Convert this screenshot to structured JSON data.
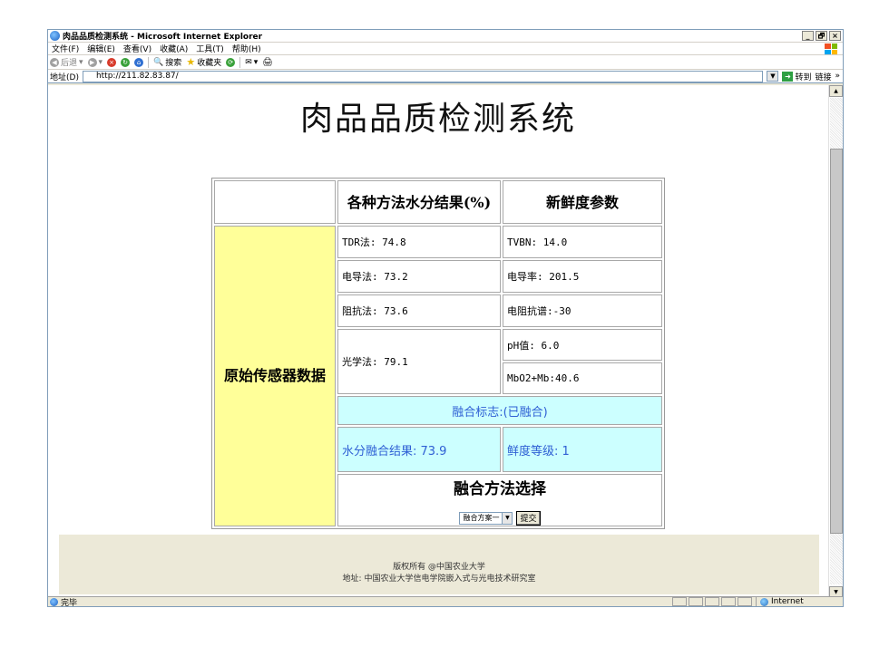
{
  "window": {
    "title": "肉品品质检测系统 - Microsoft Internet Explorer",
    "controls": [
      "_",
      "🗗",
      "×"
    ]
  },
  "menubar": {
    "items": [
      "文件(F)",
      "编辑(E)",
      "查看(V)",
      "收藏(A)",
      "工具(T)",
      "帮助(H)"
    ]
  },
  "toolbar": {
    "back": "后退",
    "search": "搜索",
    "favorites": "收藏夹"
  },
  "addressbar": {
    "label": "地址(D)",
    "url": "http://211.82.83.87/",
    "go": "转到",
    "links": "链接",
    "more": "»"
  },
  "page": {
    "title": "肉品品质检测系统",
    "header_water": "各种方法水分结果(%)",
    "header_freshness": "新鲜度参数",
    "sensor_label": "原始传感器数据",
    "water": {
      "tdr": "TDR法: 74.8",
      "conductivity": "电导法: 73.2",
      "impedance": "阻抗法:  73.6",
      "optical": "光学法: 79.1"
    },
    "freshness": {
      "tvbn": "TVBN:  14.0",
      "conductivity_rate": "电导率: 201.5",
      "impedance_spectrum": "电阻抗谱:-30",
      "ph": "pH值:  6.0",
      "mbo2": "MbO2+Mb:40.6"
    },
    "fusion_flag": "融合标志:(已融合)",
    "fusion_water": "水分融合结果:  73.9",
    "freshness_grade": "鲜度等级:  1",
    "method_title": "融合方法选择",
    "method_select": "融合方案一",
    "submit": "提交"
  },
  "footer": {
    "copyright": "版权所有 @中国农业大学",
    "address": "地址: 中国农业大学信电学院嵌入式与光电技术研究室"
  },
  "statusbar": {
    "status": "完毕",
    "zone": "Internet"
  },
  "colors": {
    "sensor_bg": "#ffff99",
    "fusion_bg": "#ccffff",
    "fusion_text": "#2e5fd4",
    "footer_bg": "#ece9d8"
  }
}
